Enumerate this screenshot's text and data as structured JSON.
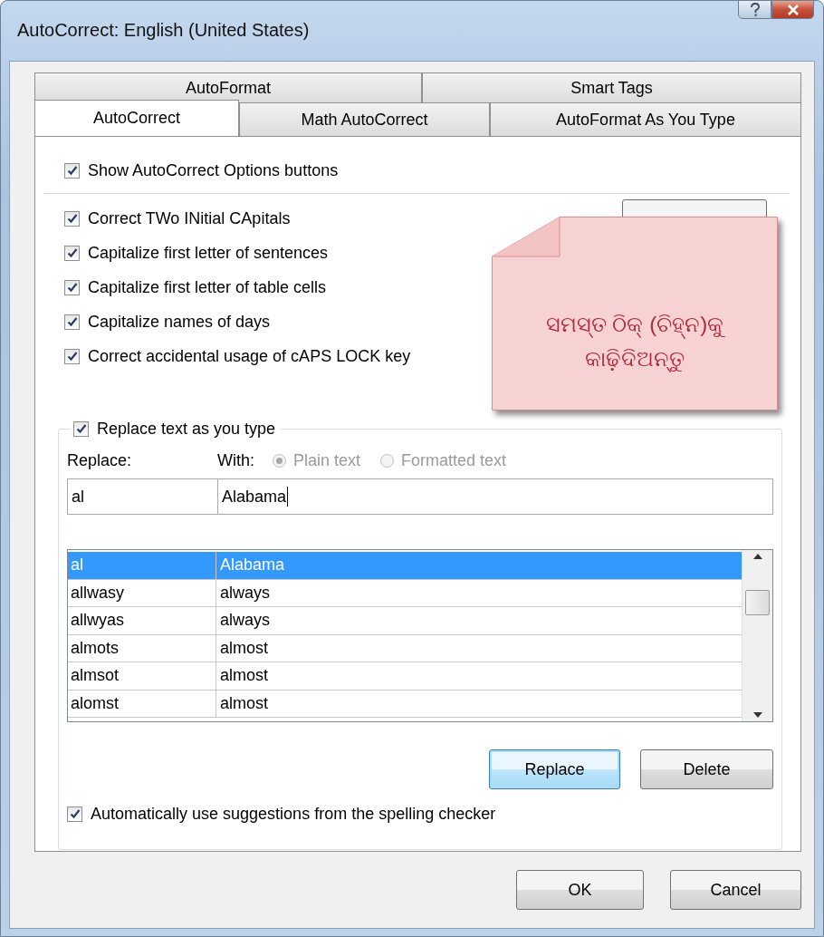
{
  "window": {
    "title": "AutoCorrect: English (United States)"
  },
  "tab_rows": [
    [
      {
        "label": "AutoFormat",
        "selected": false
      },
      {
        "label": "Smart Tags",
        "selected": false
      }
    ],
    [
      {
        "label": "AutoCorrect",
        "selected": true
      },
      {
        "label": "Math AutoCorrect",
        "selected": false
      },
      {
        "label": "AutoFormat As You Type",
        "selected": false
      }
    ]
  ],
  "show_options_button": {
    "label": "Show AutoCorrect Options buttons",
    "checked": true
  },
  "capitalization_options": [
    {
      "label": "Correct TWo INitial CApitals",
      "checked": true
    },
    {
      "label": "Capitalize first letter of sentences",
      "checked": true
    },
    {
      "label": "Capitalize first letter of table cells",
      "checked": true
    },
    {
      "label": "Capitalize names of days",
      "checked": true
    },
    {
      "label": "Correct accidental usage of cAPS LOCK key",
      "checked": true
    }
  ],
  "note": {
    "lines": [
      "ସମସ୍ତ ଠିକ୍ (ଚିହ୍ନ)କୁ",
      "କାଢ଼ିଦିଅନ୍ତୁ"
    ]
  },
  "replace_text": {
    "label": "Replace text as you type",
    "checked": true
  },
  "replace_label": "Replace:",
  "with_label": "With:",
  "format_radios": [
    {
      "label": "Plain text",
      "selected": true,
      "disabled": true
    },
    {
      "label": "Formatted text",
      "selected": false,
      "disabled": true
    }
  ],
  "replace_value": "al",
  "with_value": "Alabama",
  "entries": [
    {
      "replace": "al",
      "with": "Alabama",
      "selected": true
    },
    {
      "replace": "allwasy",
      "with": "always",
      "selected": false
    },
    {
      "replace": "allwyas",
      "with": "always",
      "selected": false
    },
    {
      "replace": "almots",
      "with": "almost",
      "selected": false
    },
    {
      "replace": "almsot",
      "with": "almost",
      "selected": false
    },
    {
      "replace": "alomst",
      "with": "almost",
      "selected": false
    }
  ],
  "entry_buttons": [
    {
      "label": "Replace",
      "default": true
    },
    {
      "label": "Delete",
      "default": false
    }
  ],
  "spelling_option": {
    "label": "Automatically use suggestions from the spelling checker",
    "checked": true
  },
  "buttons": [
    "OK",
    "Cancel"
  ]
}
